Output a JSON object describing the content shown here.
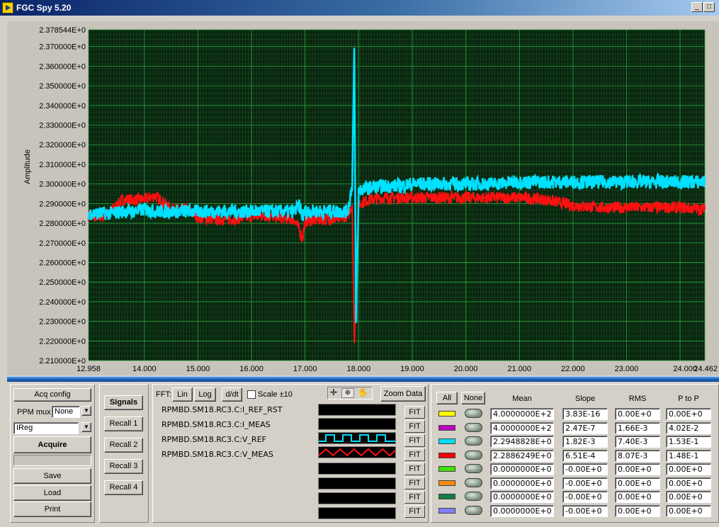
{
  "window": {
    "title": "FGC Spy 5.20"
  },
  "colors": {
    "trace_cyan": "#00e0ff",
    "trace_red": "#ff1010",
    "plot_bg": "#0a2410",
    "grid": "#1f7a2c"
  },
  "chart_data": {
    "type": "line",
    "ylabel": "Amplitude",
    "ylim": [
      2.21,
      2.378544
    ],
    "xlim": [
      12.958,
      24.462
    ],
    "y_ticks": [
      "2.378544E+0",
      "2.370000E+0",
      "2.360000E+0",
      "2.350000E+0",
      "2.340000E+0",
      "2.330000E+0",
      "2.320000E+0",
      "2.310000E+0",
      "2.300000E+0",
      "2.290000E+0",
      "2.280000E+0",
      "2.270000E+0",
      "2.260000E+0",
      "2.250000E+0",
      "2.240000E+0",
      "2.230000E+0",
      "2.220000E+0",
      "2.210000E+0"
    ],
    "x_ticks": [
      "12.958",
      "14.000",
      "15.000",
      "16.000",
      "17.000",
      "18.000",
      "19.000",
      "20.000",
      "21.000",
      "22.000",
      "23.000",
      "24.000",
      "24.462"
    ],
    "series": [
      {
        "color": "#ff1010",
        "x": [
          12.958,
          13.2,
          13.4,
          13.6,
          13.8,
          14.0,
          14.2,
          14.5,
          14.8,
          15.0,
          15.3,
          15.6,
          15.9,
          16.2,
          16.5,
          16.8,
          16.9,
          16.95,
          17.0,
          17.3,
          17.6,
          17.8,
          17.88,
          17.92,
          17.95,
          18.0,
          18.2,
          18.5,
          18.8,
          19.0,
          19.5,
          20.0,
          20.5,
          21.0,
          21.5,
          22.0,
          22.5,
          23.0,
          23.5,
          24.0,
          24.462
        ],
        "y": [
          2.284,
          2.283,
          2.287,
          2.292,
          2.292,
          2.292,
          2.294,
          2.287,
          2.287,
          2.283,
          2.282,
          2.282,
          2.283,
          2.284,
          2.283,
          2.282,
          2.276,
          2.272,
          2.281,
          2.282,
          2.282,
          2.284,
          2.29,
          2.217,
          2.25,
          2.29,
          2.292,
          2.293,
          2.293,
          2.293,
          2.293,
          2.293,
          2.293,
          2.293,
          2.292,
          2.289,
          2.288,
          2.288,
          2.288,
          2.288,
          2.287
        ]
      },
      {
        "color": "#00e0ff",
        "x": [
          12.958,
          13.2,
          13.4,
          13.6,
          13.8,
          14.0,
          14.2,
          14.5,
          14.8,
          15.0,
          15.3,
          15.6,
          15.9,
          16.2,
          16.5,
          16.8,
          16.9,
          16.95,
          17.0,
          17.3,
          17.6,
          17.8,
          17.88,
          17.92,
          17.95,
          18.0,
          18.2,
          18.5,
          18.8,
          19.0,
          19.5,
          20.0,
          20.5,
          21.0,
          21.5,
          22.0,
          22.5,
          23.0,
          23.5,
          24.0,
          24.462
        ],
        "y": [
          2.285,
          2.285,
          2.285,
          2.286,
          2.286,
          2.287,
          2.286,
          2.286,
          2.286,
          2.286,
          2.286,
          2.286,
          2.286,
          2.286,
          2.286,
          2.286,
          2.289,
          2.283,
          2.286,
          2.286,
          2.286,
          2.286,
          2.3,
          2.372,
          2.225,
          2.297,
          2.298,
          2.299,
          2.299,
          2.3,
          2.3,
          2.3,
          2.3,
          2.301,
          2.301,
          2.301,
          2.301,
          2.301,
          2.301,
          2.301,
          2.301
        ]
      }
    ]
  },
  "controls": {
    "acq_config": "Acq config",
    "ppm_mux_label": "PPM mux",
    "ppm_mux_value": "None",
    "ireg_value": "IReg",
    "acquire": "Acquire",
    "save": "Save",
    "load": "Load",
    "print": "Print",
    "signals": "Signals",
    "recall1": "Recall 1",
    "recall2": "Recall 2",
    "recall3": "Recall 3",
    "recall4": "Recall 4",
    "fft_label": "FFT:",
    "lin": "Lin",
    "log": "Log",
    "ddt": "d/dt",
    "scale": "Scale ±10",
    "zoom_data": "Zoom Data",
    "all": "All",
    "none": "None",
    "fit": "FIT"
  },
  "signals": [
    "RPMBD.SM18.RC3.C:I_REF_RST",
    "RPMBD.SM18.RC3.C:I_MEAS",
    "RPMBD.SM18.RC3.C:V_REF",
    "RPMBD.SM18.RC3.C:V_MEAS"
  ],
  "stats": {
    "headers": {
      "mean": "Mean",
      "slope": "Slope",
      "rms": "RMS",
      "ptop": "P to P"
    },
    "rows": [
      {
        "color": "#ffff00",
        "mean": "4.0000000E+2",
        "slope": "3.83E-16",
        "rms": "0.00E+0",
        "ptop": "0.00E+0"
      },
      {
        "color": "#c000c0",
        "mean": "4.0000000E+2",
        "slope": "2.47E-7",
        "rms": "1.66E-3",
        "ptop": "4.02E-2"
      },
      {
        "color": "#00e0ff",
        "mean": "2.2948828E+0",
        "slope": "1.82E-3",
        "rms": "7.40E-3",
        "ptop": "1.53E-1"
      },
      {
        "color": "#ff0000",
        "mean": "2.2886249E+0",
        "slope": "6.51E-4",
        "rms": "8.07E-3",
        "ptop": "1.48E-1"
      },
      {
        "color": "#40e000",
        "mean": "0.0000000E+0",
        "slope": "-0.00E+0",
        "rms": "0.00E+0",
        "ptop": "0.00E+0"
      },
      {
        "color": "#ff8c10",
        "mean": "0.0000000E+0",
        "slope": "-0.00E+0",
        "rms": "0.00E+0",
        "ptop": "0.00E+0"
      },
      {
        "color": "#108040",
        "mean": "0.0000000E+0",
        "slope": "-0.00E+0",
        "rms": "0.00E+0",
        "ptop": "0.00E+0"
      },
      {
        "color": "#8080ff",
        "mean": "0.0000000E+0",
        "slope": "-0.00E+0",
        "rms": "0.00E+0",
        "ptop": "0.00E+0"
      }
    ]
  }
}
